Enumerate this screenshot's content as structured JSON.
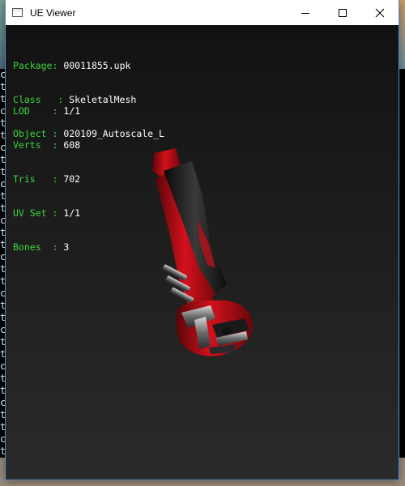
{
  "window": {
    "title": "UE Viewer",
    "controls": {
      "minimize": "minimize-icon",
      "maximize": "maximize-icon",
      "close": "close-icon"
    }
  },
  "info": {
    "package_label": "Package",
    "package_value": "00011855.upk",
    "class_label": "Class",
    "class_value": "SkeletalMesh",
    "object_label": "Object",
    "object_value": "020109_Autoscale_L",
    "lod_label": "LOD",
    "lod_value": "1/1",
    "verts_label": "Verts",
    "verts_value": "608",
    "tris_label": "Tris",
    "tris_value": "702",
    "uvset_label": "UV Set",
    "uvset_value": "1/1",
    "bones_label": "Bones",
    "bones_value": "3"
  },
  "background_console": {
    "left_chars": [
      "c",
      "t",
      "t",
      "c",
      "t",
      "t",
      "c",
      "t",
      "t",
      "c",
      "t",
      "t",
      "c",
      "t",
      "t",
      "c",
      "t",
      "t",
      "c",
      "t",
      "t",
      "c",
      "t",
      "t",
      "c",
      "t",
      "t",
      "c",
      "t",
      "t",
      "c",
      "t"
    ],
    "right_chars": [
      "",
      "",
      "",
      "",
      " ",
      "",
      "",
      "",
      "",
      "",
      "",
      "",
      "",
      "",
      "",
      "",
      "",
      "",
      "",
      "",
      "",
      "",
      "",
      "",
      "",
      "",
      "",
      "",
      "",
      "",
      "",
      ""
    ]
  },
  "colors": {
    "label_green": "#3bd63b",
    "value_white": "#ffffff",
    "mesh_red": "#c0101a"
  }
}
